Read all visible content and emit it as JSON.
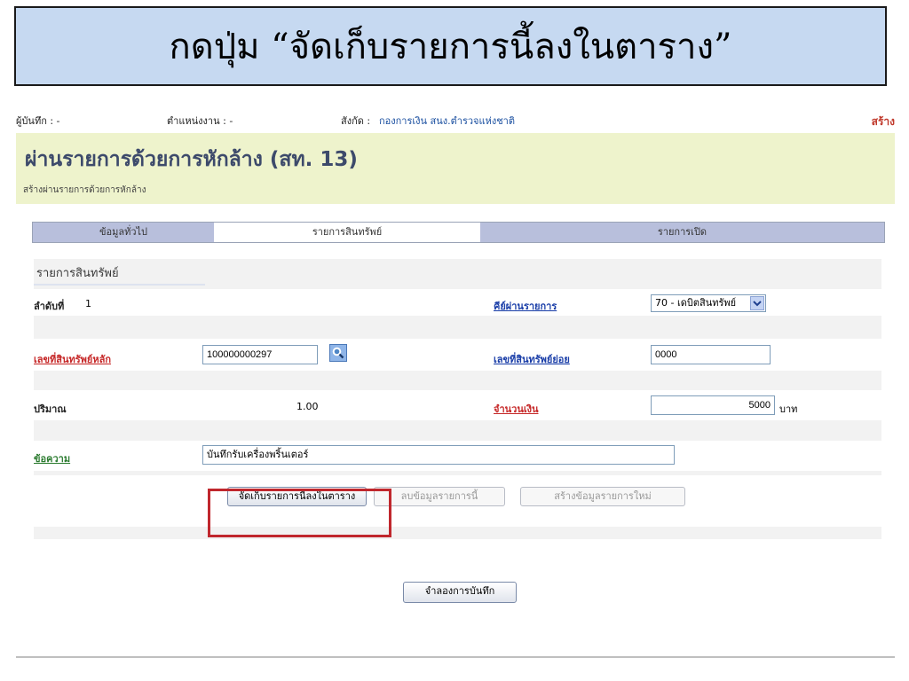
{
  "banner": {
    "text": "กดปุ่ม “จัดเก็บรายการนี้ลงในตาราง”"
  },
  "topbar": {
    "recorder": "ผู้บันทึก : -",
    "position": "ตำแหน่งงาน : -",
    "affiliation_label": "สังกัด :",
    "affiliation_value": "กองการเงิน สนง.ตำรวจแห่งชาติ",
    "create_link": "สร้าง"
  },
  "header": {
    "title": "ผ่านรายการด้วยการหักล้าง (สท. 13)",
    "subtitle": "สร้างผ่านรายการด้วยการหักล้าง"
  },
  "tabs": [
    {
      "label": "ข้อมูลทั่วไป",
      "active": false
    },
    {
      "label": "รายการสินทรัพย์",
      "active": true
    },
    {
      "label": "รายการเปิด",
      "active": false
    }
  ],
  "section": {
    "title": "รายการสินทรัพย์"
  },
  "form": {
    "seq_label": "ลำดับที่",
    "seq_value": "1",
    "posting_key_label": "คีย์ผ่านรายการ",
    "posting_key_value": "70 - เดบิตสินทรัพย์",
    "main_asset_label": "เลขที่สินทรัพย์หลัก",
    "main_asset_value": "100000000297",
    "sub_asset_label": "เลขที่สินทรัพย์ย่อย",
    "sub_asset_value": "0000",
    "quantity_label": "ปริมาณ",
    "quantity_value": "1.00",
    "amount_label": "จำนวนเงิน",
    "amount_value": "5000",
    "amount_unit": "บาท",
    "text_label": "ข้อความ",
    "text_value": "บันทึกรับเครื่องพริ้นเตอร์"
  },
  "buttons": {
    "save_row": "จัดเก็บรายการนี้ลงในตาราง",
    "delete_row": "ลบข้อมูลรายการนี้",
    "new_row": "สร้างข้อมูลรายการใหม่",
    "simulate": "จำลองการบันทึก"
  },
  "icons": {
    "search": "magnifier-icon",
    "dropdown": "chevron-down-icon"
  },
  "colors": {
    "banner_bg": "#c6d9f1",
    "header_bg": "#eef3cc",
    "highlight": "#c0272d",
    "link_red": "#c62828",
    "link_green": "#2e7d32"
  }
}
